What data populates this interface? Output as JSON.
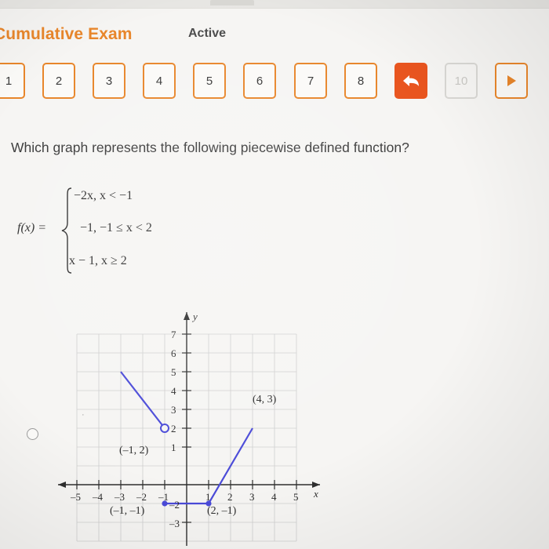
{
  "header": {
    "exam_title": "Cumulative Exam",
    "status_label": "Active"
  },
  "pager": {
    "buttons": [
      {
        "label": "1",
        "state": "normal"
      },
      {
        "label": "2",
        "state": "normal"
      },
      {
        "label": "3",
        "state": "normal"
      },
      {
        "label": "4",
        "state": "normal"
      },
      {
        "label": "5",
        "state": "normal"
      },
      {
        "label": "6",
        "state": "normal"
      },
      {
        "label": "7",
        "state": "normal"
      },
      {
        "label": "8",
        "state": "normal"
      },
      {
        "label": "",
        "state": "filled",
        "icon": "back-arrow-icon"
      },
      {
        "label": "10",
        "state": "disabled"
      },
      {
        "label": "",
        "state": "next",
        "icon": "play-arrow-icon"
      }
    ]
  },
  "question": {
    "prompt": "Which graph represents the following piecewise defined function?",
    "function_label": "f(x) =",
    "pieces": [
      "−2x, x < −1",
      "−1, −1 ≤ x < 2",
      "x − 1, x ≥ 2"
    ]
  },
  "answer_option": {
    "selected": false
  },
  "chart_data": {
    "type": "line",
    "title": "",
    "xlabel": "x",
    "ylabel": "y",
    "xlim": [
      -6,
      6
    ],
    "ylim": [
      -3.5,
      7.5
    ],
    "xticks": [
      -5,
      -4,
      -3,
      -2,
      -1,
      1,
      2,
      3,
      4,
      5
    ],
    "yticks": [
      -3,
      -2,
      -1,
      1,
      2,
      3,
      4,
      5,
      6,
      7
    ],
    "grid": true,
    "series": [
      {
        "name": "segment-1",
        "points": [
          [
            -4,
            6
          ],
          [
            -1,
            2
          ]
        ],
        "color": "#4a4ad8",
        "endpoint_open": [
          -1,
          2
        ]
      },
      {
        "name": "segment-2",
        "points": [
          [
            -1,
            -1
          ],
          [
            2,
            -1
          ]
        ],
        "color": "#4a4ad8"
      },
      {
        "name": "segment-3",
        "points": [
          [
            2,
            -1
          ],
          [
            4,
            3
          ]
        ],
        "color": "#4a4ad8"
      }
    ],
    "annotations": [
      {
        "text": "(–1, 2)",
        "x": -1,
        "y": 2
      },
      {
        "text": "(–1, –1)",
        "x": -1,
        "y": -1
      },
      {
        "text": "(2, –1)",
        "x": 2,
        "y": -1
      },
      {
        "text": "(4, 3)",
        "x": 4,
        "y": 3
      }
    ]
  },
  "axis_tick_labels": {
    "x": [
      "–5",
      "–4",
      "–3",
      "–2",
      "–1",
      "1",
      "2",
      "3",
      "4",
      "5"
    ],
    "y": [
      "7",
      "6",
      "5",
      "4",
      "3",
      "2",
      "1",
      "–2",
      "–3"
    ],
    "x_axis_name": "x",
    "y_axis_name": "y"
  },
  "colors": {
    "accent_orange": "#e8862b",
    "accent_red": "#e9551f",
    "curve_blue": "#4a4ad8",
    "background": "#f6f5f3"
  }
}
